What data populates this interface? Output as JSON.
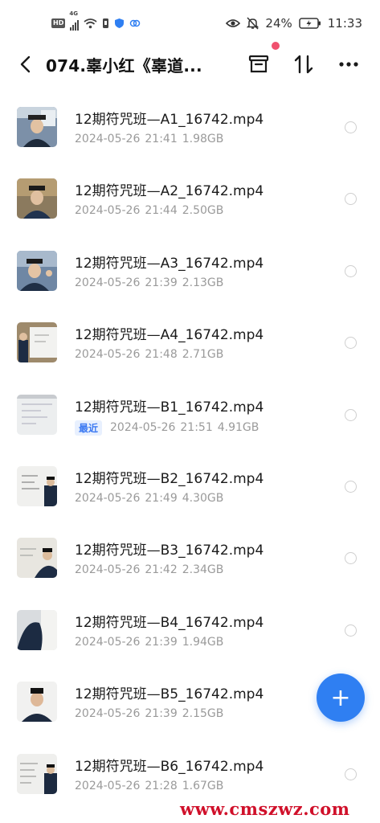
{
  "status_bar": {
    "hd": "HD",
    "network": "4G",
    "battery_percent": "24%",
    "time": "11:33",
    "icons": [
      "hd-icon",
      "signal-icon",
      "wifi-icon",
      "sim-icon",
      "shield-icon",
      "vpn-icon",
      "eye-icon",
      "mute-icon",
      "battery-icon"
    ]
  },
  "header": {
    "title": "074.辜小红《辜道...",
    "icons": [
      "back-arrow-icon",
      "archive-icon",
      "sort-icon",
      "more-icon"
    ]
  },
  "files": [
    {
      "name": "12期符咒班—A1_16742.mp4",
      "date": "2024-05-26",
      "time": "21:41",
      "size": "1.98GB",
      "tag": ""
    },
    {
      "name": "12期符咒班—A2_16742.mp4",
      "date": "2024-05-26",
      "time": "21:44",
      "size": "2.50GB",
      "tag": ""
    },
    {
      "name": "12期符咒班—A3_16742.mp4",
      "date": "2024-05-26",
      "time": "21:39",
      "size": "2.13GB",
      "tag": ""
    },
    {
      "name": "12期符咒班—A4_16742.mp4",
      "date": "2024-05-26",
      "time": "21:48",
      "size": "2.71GB",
      "tag": ""
    },
    {
      "name": "12期符咒班—B1_16742.mp4",
      "date": "2024-05-26",
      "time": "21:51",
      "size": "4.91GB",
      "tag": "最近"
    },
    {
      "name": "12期符咒班—B2_16742.mp4",
      "date": "2024-05-26",
      "time": "21:49",
      "size": "4.30GB",
      "tag": ""
    },
    {
      "name": "12期符咒班—B3_16742.mp4",
      "date": "2024-05-26",
      "time": "21:42",
      "size": "2.34GB",
      "tag": ""
    },
    {
      "name": "12期符咒班—B4_16742.mp4",
      "date": "2024-05-26",
      "time": "21:39",
      "size": "1.94GB",
      "tag": ""
    },
    {
      "name": "12期符咒班—B5_16742.mp4",
      "date": "2024-05-26",
      "time": "21:39",
      "size": "2.15GB",
      "tag": ""
    },
    {
      "name": "12期符咒班—B6_16742.mp4",
      "date": "2024-05-26",
      "time": "21:28",
      "size": "1.67GB",
      "tag": ""
    }
  ],
  "fab": {
    "label": "+",
    "icon": "plus-icon"
  },
  "watermark": "www.cmszwz.com",
  "colors": {
    "accent": "#2f7ff2",
    "notification_dot": "#f0506e",
    "meta_text": "#9a9a9a",
    "watermark": "#d0102a"
  }
}
